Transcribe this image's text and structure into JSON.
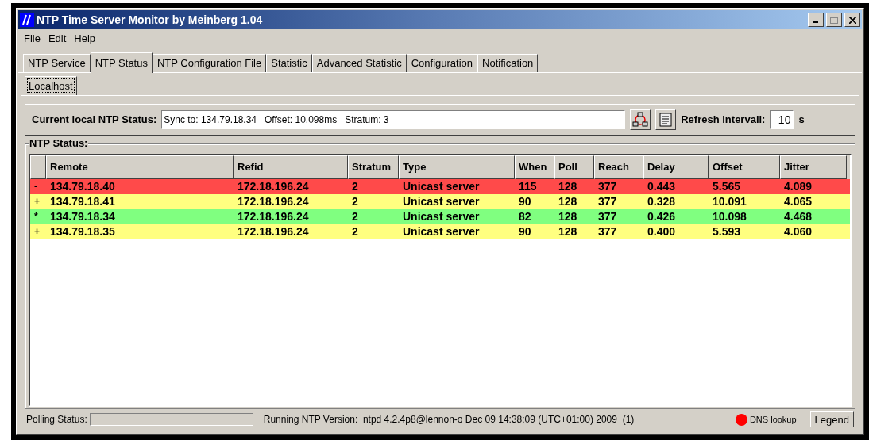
{
  "window": {
    "title": "NTP Time Server Monitor by Meinberg 1.04"
  },
  "menu": [
    "File",
    "Edit",
    "Help"
  ],
  "tabs": [
    {
      "label": "NTP Service",
      "selected": false
    },
    {
      "label": "NTP Status",
      "selected": true
    },
    {
      "label": "NTP Configuration File",
      "selected": false
    },
    {
      "label": "Statistic",
      "selected": false
    },
    {
      "label": "Advanced Statistic",
      "selected": false
    },
    {
      "label": "Configuration",
      "selected": false
    },
    {
      "label": "Notification",
      "selected": false
    }
  ],
  "subtabs": [
    {
      "label": "Localhost",
      "selected": true
    }
  ],
  "current_status": {
    "label": "Current local NTP Status:",
    "value": "Sync to: 134.79.18.34   Offset: 10.098ms   Stratum: 3"
  },
  "refresh": {
    "label": "Refresh Intervall:",
    "value": "10",
    "unit": "s"
  },
  "group_title": "NTP Status:",
  "table": {
    "columns": [
      "",
      "Remote",
      "Refid",
      "Stratum",
      "Type",
      "When",
      "Poll",
      "Reach",
      "Delay",
      "Offset",
      "Jitter"
    ],
    "rows": [
      {
        "color": "#ff4a4a",
        "cells": [
          "-",
          "134.79.18.40",
          "172.18.196.24",
          "2",
          "Unicast server",
          "115",
          "128",
          "377",
          "0.443",
          "5.565",
          "4.089"
        ]
      },
      {
        "color": "#ffff80",
        "cells": [
          "+",
          "134.79.18.41",
          "172.18.196.24",
          "2",
          "Unicast server",
          "90",
          "128",
          "377",
          "0.328",
          "10.091",
          "4.065"
        ]
      },
      {
        "color": "#80ff80",
        "cells": [
          "*",
          "134.79.18.34",
          "172.18.196.24",
          "2",
          "Unicast server",
          "82",
          "128",
          "377",
          "0.426",
          "10.098",
          "4.468"
        ]
      },
      {
        "color": "#ffff80",
        "cells": [
          "+",
          "134.79.18.35",
          "172.18.196.24",
          "2",
          "Unicast server",
          "90",
          "128",
          "377",
          "0.400",
          "5.593",
          "4.060"
        ]
      }
    ]
  },
  "status_bar": {
    "polling_label": "Polling Status:",
    "version": "Running NTP Version:  ntpd 4.2.4p8@lennon-o Dec 09 14:38:09 (UTC+01:00) 2009  (1)",
    "dns": {
      "label": "DNS lookup",
      "color": "#ff0000"
    },
    "legend_button": "Legend"
  }
}
